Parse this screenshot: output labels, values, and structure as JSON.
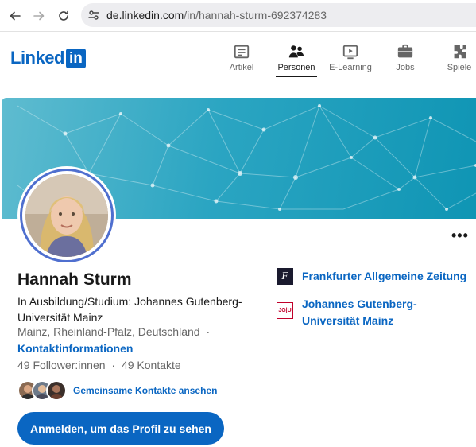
{
  "browser": {
    "url_host": "de.linkedin.com",
    "url_path": "/in/hannah-sturm-692374283"
  },
  "header": {
    "logo_text": "Linked",
    "logo_badge": "in",
    "nav": [
      {
        "label": "Artikel",
        "icon": "article-icon"
      },
      {
        "label": "Personen",
        "icon": "people-icon",
        "active": true
      },
      {
        "label": "E-Learning",
        "icon": "learning-icon"
      },
      {
        "label": "Jobs",
        "icon": "briefcase-icon"
      },
      {
        "label": "Spiele",
        "icon": "puzzle-icon"
      }
    ]
  },
  "profile": {
    "name": "Hannah Sturm",
    "headline": "In Ausbildung/Studium: Johannes Gutenberg-Universität Mainz",
    "location": "Mainz, Rheinland-Pfalz, Deutschland",
    "location_separator": "·",
    "contact_info_label": "Kontaktinformationen",
    "followers": "49 Follower:innen",
    "counts_separator": "·",
    "connections": "49 Kontakte",
    "mutual_contacts_label": "Gemeinsame Kontakte ansehen",
    "more_label": "•••",
    "signin_button": "Anmelden, um das Profil zu sehen"
  },
  "organizations": [
    {
      "name": "Frankfurter Allgemeine Zeitung",
      "logo_text": "F",
      "logo_color": "#1a1a2e"
    },
    {
      "name": "Johannes Gutenberg-Universität Mainz",
      "logo_text": "JG|U",
      "logo_color": "#c1002a"
    }
  ],
  "colors": {
    "accent": "#0a66c2",
    "banner": "#1aa0bf"
  }
}
